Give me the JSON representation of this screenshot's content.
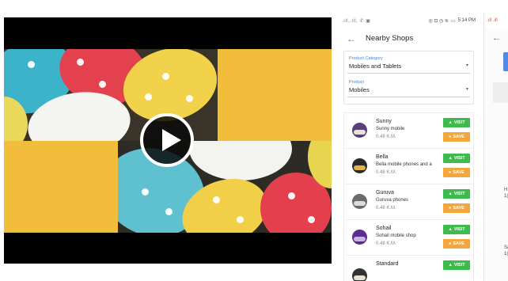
{
  "phone": {
    "status_left": ".ıll,.ıll, ✆ ▣",
    "status_time": "5:14 PM",
    "title": "Nearby Shops",
    "filters": [
      {
        "label": "Product Category",
        "value": "Mobiles and Tablets"
      },
      {
        "label": "Product",
        "value": "Mobiles"
      }
    ],
    "visit_label": "VISIT",
    "save_label": "SAVE",
    "shops": [
      {
        "name": "Sunny",
        "desc": "Sunny mobile",
        "distance": "0.48 K.M."
      },
      {
        "name": "Bella",
        "desc": "Bella mobile phones and a",
        "distance": "0.48 K.M."
      },
      {
        "name": "Guruva",
        "desc": "Guruva phones",
        "distance": "0.48 K.M."
      },
      {
        "name": "Sohail",
        "desc": "Sohail mobile shop",
        "distance": "0.48 K.M."
      },
      {
        "name": "Standard",
        "desc": "",
        "distance": ""
      }
    ]
  },
  "phone2": {
    "status_left": ".ıll .ıll",
    "texts": [
      "H",
      "1(",
      "Sa",
      "1("
    ]
  },
  "colors": {
    "accent_blue": "#3f7fe0",
    "visit_green": "#3dbb4c",
    "save_orange": "#f4a63b",
    "video_yellow": "#f2bd3a"
  }
}
